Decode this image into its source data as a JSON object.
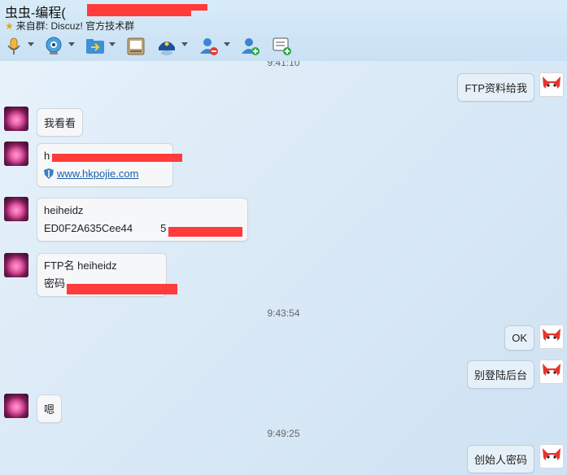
{
  "header": {
    "title": "虫虫-编程(",
    "subtitle_prefix": "来自群:",
    "subtitle_group": "Discuz! 官方技术群"
  },
  "toolbar": {
    "items": [
      {
        "icon": "microphone-icon"
      },
      {
        "icon": "camera-icon"
      },
      {
        "icon": "send-file-icon"
      },
      {
        "icon": "screen-icon"
      },
      {
        "icon": "group-admin-icon"
      },
      {
        "icon": "remove-contact-icon"
      },
      {
        "icon": "add-contact-icon"
      },
      {
        "icon": "message-record-icon"
      }
    ]
  },
  "chat": {
    "timestamps": [
      "9:41:10",
      "9:43:54",
      "9:49:25"
    ],
    "messages": [
      {
        "side": "right",
        "text": "FTP资料给我"
      },
      {
        "side": "left",
        "text": "我看看"
      },
      {
        "side": "left",
        "line1": "h",
        "link": "www.hkpojie.com"
      },
      {
        "side": "left",
        "line1": "heiheidz",
        "line2_a": "ED0F2A635Cee44",
        "line2_b": "5"
      },
      {
        "side": "left",
        "line1": "FTP名 heiheidz",
        "line2": "密码"
      },
      {
        "side": "right",
        "text": "OK"
      },
      {
        "side": "right",
        "text": "别登陆后台"
      },
      {
        "side": "left",
        "text": "嗯"
      },
      {
        "side": "right",
        "text": "创始人密码"
      }
    ]
  }
}
